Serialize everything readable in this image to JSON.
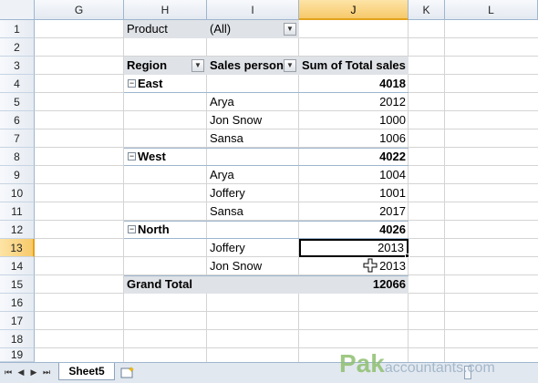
{
  "columns": [
    "G",
    "H",
    "I",
    "J",
    "K",
    "L"
  ],
  "rows": [
    "1",
    "2",
    "3",
    "4",
    "5",
    "6",
    "7",
    "8",
    "9",
    "10",
    "11",
    "12",
    "13",
    "14",
    "15",
    "16",
    "17",
    "18",
    "19"
  ],
  "filter": {
    "label": "Product",
    "value": "(All)"
  },
  "pivot_headers": {
    "region": "Region",
    "sales_person": "Sales person",
    "sum": "Sum of Total sales"
  },
  "pivot_rows": [
    {
      "region": "East",
      "total": "4018",
      "people": [
        {
          "name": "Arya",
          "value": "2012"
        },
        {
          "name": "Jon Snow",
          "value": "1000"
        },
        {
          "name": "Sansa",
          "value": "1006"
        }
      ]
    },
    {
      "region": "West",
      "total": "4022",
      "people": [
        {
          "name": "Arya",
          "value": "1004"
        },
        {
          "name": "Joffery",
          "value": "1001"
        },
        {
          "name": "Sansa",
          "value": "2017"
        }
      ]
    },
    {
      "region": "North",
      "total": "4026",
      "people": [
        {
          "name": "Joffery",
          "value": "2013"
        },
        {
          "name": "Jon Snow",
          "value": "2013"
        }
      ]
    }
  ],
  "grand_total": {
    "label": "Grand Total",
    "value": "12066"
  },
  "sheet_tab": "Sheet5",
  "watermark": {
    "brand": "Pak",
    "rest": "accountants.com"
  },
  "colors": {
    "selection_header": "#f7c96a",
    "pivot_header_bg": "#dfe2e6",
    "grid": "#d4d4d4"
  }
}
